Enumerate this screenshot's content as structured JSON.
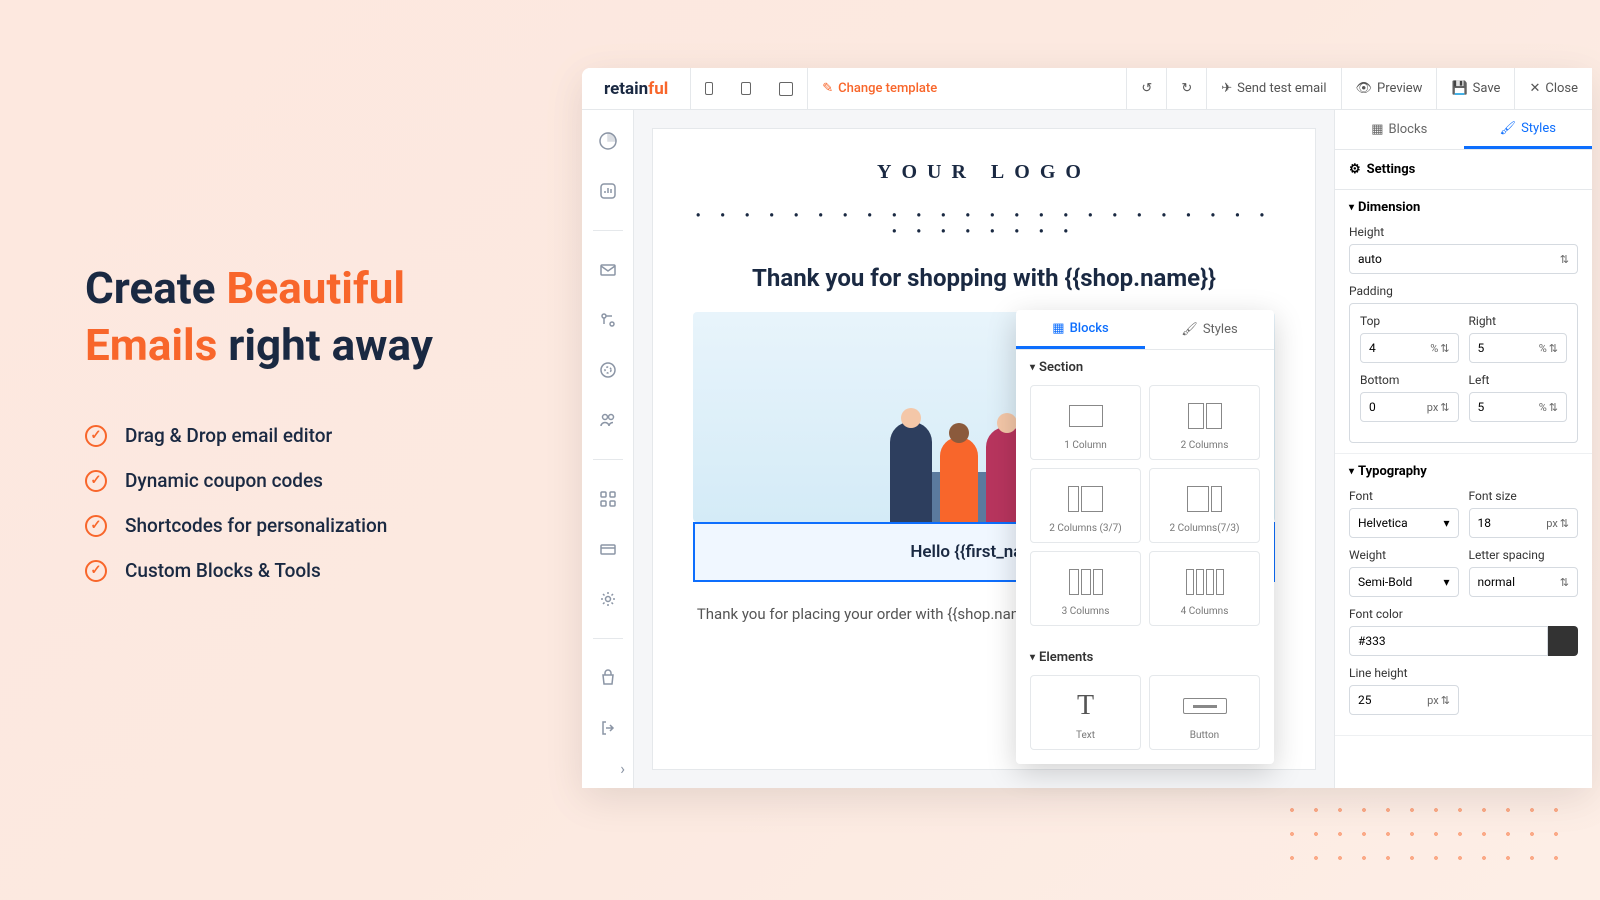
{
  "hero": {
    "line1a": "Create ",
    "line1b": "Beautiful",
    "line2a": "Emails",
    "line2b": " right away"
  },
  "features": [
    "Drag & Drop email editor",
    "Dynamic coupon codes",
    "Shortcodes for personalization",
    "Custom Blocks & Tools"
  ],
  "logo": {
    "retain": "retain",
    "ful": "ful"
  },
  "toolbar": {
    "change_template": "Change template",
    "send_test": "Send test email",
    "preview": "Preview",
    "save": "Save",
    "close": "Close"
  },
  "email": {
    "logo": "YOUR LOGO",
    "headline": "Thank you for shopping with {{shop.name}}",
    "greeting": "Hello {{first_name}}",
    "body": "Thank you for placing your order with {{shop.name}} that you chose our store, it means"
  },
  "blocks_panel": {
    "tab_blocks": "Blocks",
    "tab_styles": "Styles",
    "section": "Section",
    "elements": "Elements",
    "items": {
      "c1": "1 Column",
      "c2": "2 Columns",
      "c37": "2 Columns (3/7)",
      "c73": "2 Columns(7/3)",
      "c3": "3 Columns",
      "c4": "4 Columns",
      "text": "Text",
      "button": "Button"
    }
  },
  "styles_panel": {
    "tab_blocks": "Blocks",
    "tab_styles": "Styles",
    "settings": "Settings",
    "dimension": "Dimension",
    "height_label": "Height",
    "height_value": "auto",
    "padding": "Padding",
    "top": "Top",
    "right": "Right",
    "bottom": "Bottom",
    "left": "Left",
    "pad_top": "4",
    "pad_right": "5",
    "pad_bottom": "0",
    "pad_left": "5",
    "pct": "%",
    "px": "px",
    "typography": "Typography",
    "font": "Font",
    "font_value": "Helvetica",
    "font_size": "Font size",
    "font_size_value": "18",
    "weight": "Weight",
    "weight_value": "Semi-Bold",
    "letter_spacing": "Letter spacing",
    "letter_spacing_value": "normal",
    "font_color": "Font color",
    "font_color_value": "#333",
    "line_height": "Line height",
    "line_height_value": "25"
  }
}
